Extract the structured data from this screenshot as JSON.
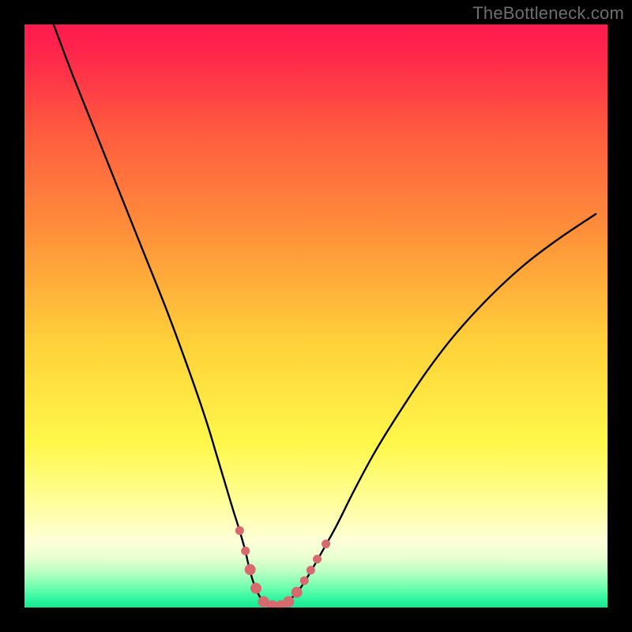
{
  "watermark": "TheBottleneck.com",
  "colors": {
    "black": "#000000",
    "curve": "#000000",
    "marker_fill": "#d76a6f",
    "marker_stroke": "#c85b60",
    "grad_stops": [
      {
        "offset": 0.0,
        "color": "#ff1a4f"
      },
      {
        "offset": 0.06,
        "color": "#ff2a4a"
      },
      {
        "offset": 0.18,
        "color": "#ff5a3f"
      },
      {
        "offset": 0.35,
        "color": "#ff8e3a"
      },
      {
        "offset": 0.55,
        "color": "#ffd23a"
      },
      {
        "offset": 0.72,
        "color": "#fff84a"
      },
      {
        "offset": 0.82,
        "color": "#fffe9a"
      },
      {
        "offset": 0.885,
        "color": "#ffffd8"
      },
      {
        "offset": 0.915,
        "color": "#e8ffd0"
      },
      {
        "offset": 0.94,
        "color": "#b6ffc0"
      },
      {
        "offset": 0.965,
        "color": "#70ffb0"
      },
      {
        "offset": 0.985,
        "color": "#30f7a0"
      },
      {
        "offset": 1.0,
        "color": "#18e892"
      }
    ]
  },
  "chart_data": {
    "type": "line",
    "title": "",
    "xlabel": "",
    "ylabel": "",
    "xlim": [
      0,
      100
    ],
    "ylim": [
      0,
      100
    ],
    "series": [
      {
        "name": "curve",
        "x": [
          5,
          8,
          12,
          16,
          20,
          24,
          27,
          29.5,
          31.5,
          33,
          34.5,
          35.7,
          36.8,
          37.8,
          38.5,
          39.2,
          40,
          41,
          42.2,
          43.5,
          44.8,
          46,
          47.3,
          49,
          51,
          53.5,
          56.5,
          60,
          64,
          69,
          74,
          80,
          86,
          92,
          98
        ],
        "y": [
          100,
          92,
          82,
          72,
          62,
          52,
          44,
          37,
          31,
          26,
          21,
          17,
          13.5,
          10,
          7,
          4.5,
          2.5,
          1,
          0.3,
          0.2,
          0.8,
          1.8,
          3.3,
          6,
          9.5,
          14,
          20,
          26.5,
          33,
          40.5,
          47,
          53.5,
          59,
          63.5,
          67.5
        ]
      }
    ],
    "markers": [
      {
        "x": 36.9,
        "y": 13.2,
        "r": 5.5
      },
      {
        "x": 37.9,
        "y": 9.7,
        "r": 5.5
      },
      {
        "x": 38.7,
        "y": 6.5,
        "r": 7.0
      },
      {
        "x": 39.7,
        "y": 3.3,
        "r": 7.0
      },
      {
        "x": 41.0,
        "y": 1.0,
        "r": 7.0
      },
      {
        "x": 42.5,
        "y": 0.3,
        "r": 7.0
      },
      {
        "x": 44.0,
        "y": 0.3,
        "r": 7.0
      },
      {
        "x": 45.3,
        "y": 1.0,
        "r": 7.0
      },
      {
        "x": 46.7,
        "y": 2.6,
        "r": 7.0
      },
      {
        "x": 48.0,
        "y": 4.6,
        "r": 5.5
      },
      {
        "x": 49.1,
        "y": 6.4,
        "r": 5.5
      },
      {
        "x": 50.2,
        "y": 8.3,
        "r": 5.5
      },
      {
        "x": 51.7,
        "y": 10.9,
        "r": 5.5
      }
    ]
  }
}
